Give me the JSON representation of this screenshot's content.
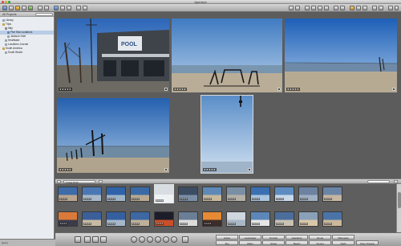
{
  "window": {
    "title": "Aperture",
    "app_label": "Aperture"
  },
  "sidebar": {
    "header": "All Projects",
    "items": [
      {
        "label": "Library"
      },
      {
        "label": "Trips"
      },
      {
        "label": "Italy"
      },
      {
        "label": "Five Star Locations"
      },
      {
        "label": "Jackson Hole"
      },
      {
        "label": "Heathlake"
      },
      {
        "label": "Locations Journal"
      },
      {
        "label": "South America"
      },
      {
        "label": "South Beach"
      }
    ],
    "selected_index": 3,
    "bottom_label": "Query"
  },
  "viewer": {
    "images": [
      {
        "name": "Pool building",
        "rating": "★★★★★"
      },
      {
        "name": "Beach with benches",
        "rating": "★★★★★"
      },
      {
        "name": "Blue sky beach",
        "rating": "★★★★★"
      },
      {
        "name": "Pier posts",
        "rating": "★★★★★"
      },
      {
        "name": "Vertical sky post",
        "rating": "★★★★★"
      }
    ]
  },
  "filmstrip": {
    "filter_label": "Image Data",
    "thumb_ratings": "★★★★"
  },
  "bottombar": {
    "keywords": [
      "Action",
      "Landscape",
      "Portrait",
      "Headshot",
      "Group",
      "Silhouette",
      "Sky",
      "Water",
      "Street",
      "Beach",
      "Sunset",
      "Night"
    ],
    "more_label": "More Presets"
  },
  "colors": {
    "accent": "#b9cde6",
    "viewer_bg": "#5c5c5c",
    "rating_bg": "#000000"
  }
}
